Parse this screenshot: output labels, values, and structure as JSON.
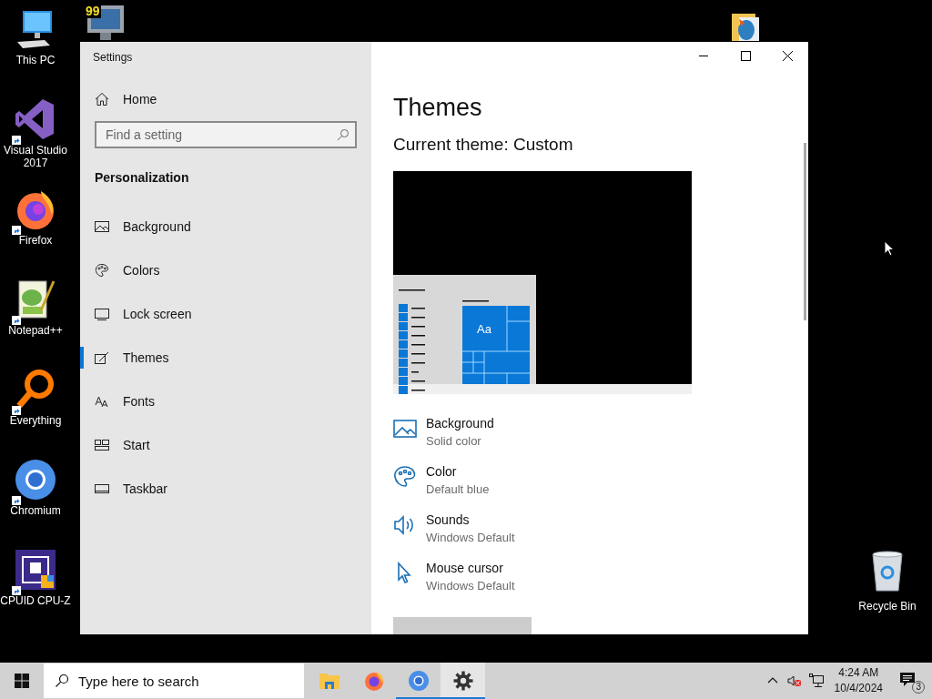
{
  "desktop_icons": [
    {
      "kind": "this-pc",
      "label": "This PC",
      "shortcut": false
    },
    {
      "kind": "visual-studio",
      "label": "Visual Studio 2017",
      "shortcut": true
    },
    {
      "kind": "firefox",
      "label": "Firefox",
      "shortcut": true
    },
    {
      "kind": "notepad",
      "label": "Notepad++",
      "shortcut": true
    },
    {
      "kind": "everything",
      "label": "Everything",
      "shortcut": true
    },
    {
      "kind": "chromium",
      "label": "Chromium",
      "shortcut": true
    },
    {
      "kind": "cpuz",
      "label": "CPUID CPU-Z",
      "shortcut": true
    }
  ],
  "partial_icons": [
    {
      "kind": "monitor",
      "badge": "99"
    },
    {
      "kind": "document"
    }
  ],
  "recycle_bin": {
    "label": "Recycle Bin"
  },
  "settings": {
    "title": "Settings",
    "home": "Home",
    "search": {
      "placeholder": "Find a setting"
    },
    "section": "Personalization",
    "nav_items": [
      {
        "kind": "background",
        "label": "Background",
        "selected": false
      },
      {
        "kind": "colors",
        "label": "Colors",
        "selected": false
      },
      {
        "kind": "lock",
        "label": "Lock screen",
        "selected": false
      },
      {
        "kind": "themes",
        "label": "Themes",
        "selected": true
      },
      {
        "kind": "fonts",
        "label": "Fonts",
        "selected": false
      },
      {
        "kind": "start",
        "label": "Start",
        "selected": false
      },
      {
        "kind": "taskbar",
        "label": "Taskbar",
        "selected": false
      }
    ],
    "heading": "Themes",
    "current_theme": "Current theme: Custom",
    "preview": {
      "tile_text": "Aa"
    },
    "options": [
      {
        "kind": "background",
        "title": "Background",
        "value": "Solid color"
      },
      {
        "kind": "color",
        "title": "Color",
        "value": "Default blue"
      },
      {
        "kind": "sounds",
        "title": "Sounds",
        "value": "Windows Default"
      },
      {
        "kind": "cursor",
        "title": "Mouse cursor",
        "value": "Windows Default"
      }
    ]
  },
  "taskbar": {
    "search": {
      "placeholder": "Type here to search"
    },
    "apps": [
      {
        "kind": "explorer",
        "running": false,
        "active": false
      },
      {
        "kind": "firefox",
        "running": false,
        "active": false
      },
      {
        "kind": "chromium",
        "running": true,
        "active": false
      },
      {
        "kind": "settings",
        "running": true,
        "active": true
      }
    ],
    "time": "4:24 AM",
    "date": "10/4/2024",
    "notifications": "3"
  }
}
